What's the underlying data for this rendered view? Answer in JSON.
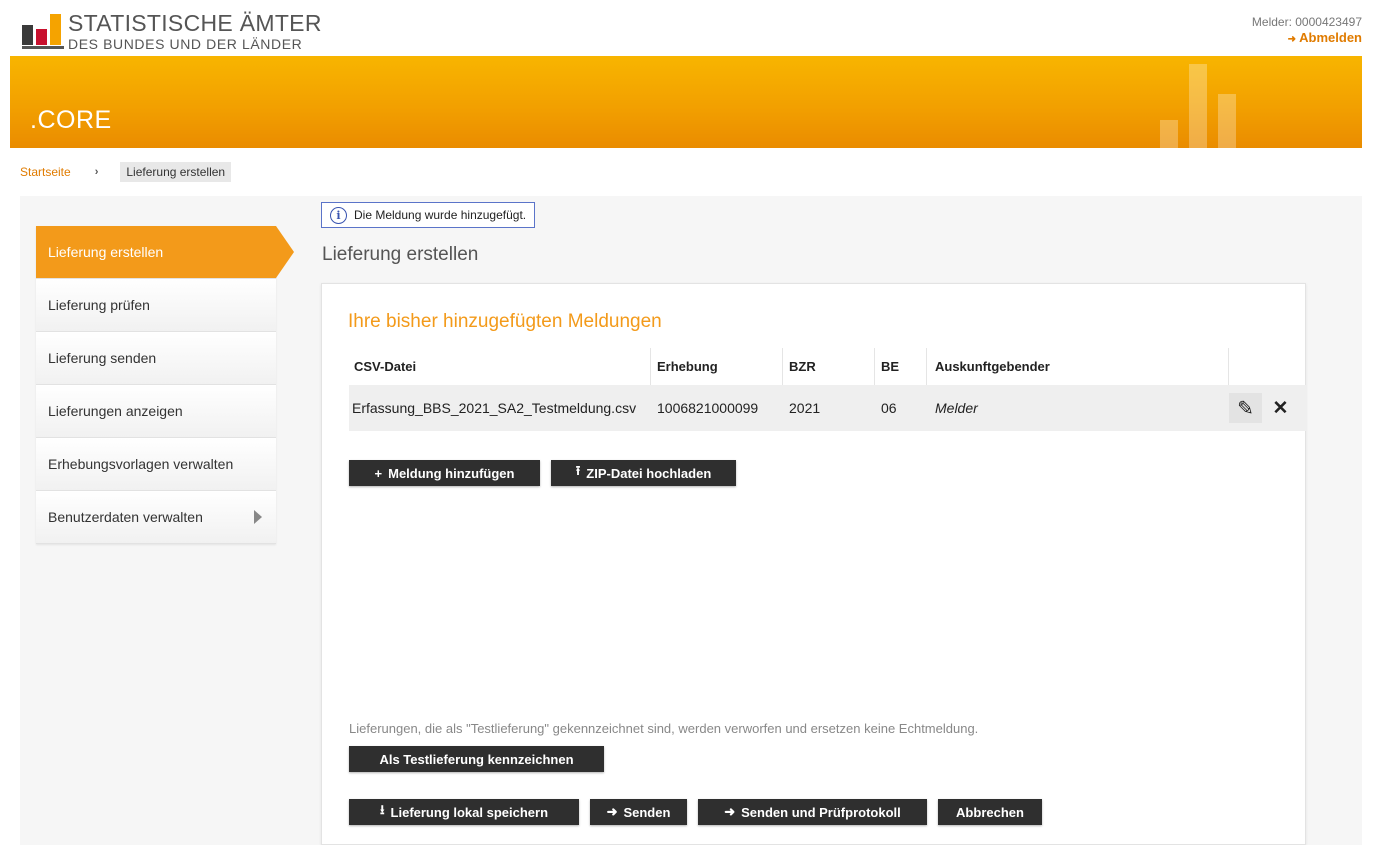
{
  "header": {
    "logo_line1": "STATISTISCHE ÄMTER",
    "logo_line2": "DES BUNDES UND DER LÄNDER",
    "melder": "Melder: 0000423497",
    "logout_icon": "arrow-right-icon",
    "logout_icon_glyph": "➜",
    "logout_label": "Abmelden",
    "app_title": ".CORE"
  },
  "breadcrumb": {
    "home": "Startseite",
    "separator": "›",
    "current": "Lieferung erstellen"
  },
  "sidebar": {
    "items": [
      {
        "label": "Lieferung erstellen",
        "active": true
      },
      {
        "label": "Lieferung prüfen"
      },
      {
        "label": "Lieferung senden"
      },
      {
        "label": "Lieferungen anzeigen"
      },
      {
        "label": "Erhebungsvorlagen verwalten"
      },
      {
        "label": "Benutzerdaten verwalten",
        "submenu": true
      }
    ]
  },
  "info_message": {
    "icon_glyph": "i",
    "text": "Die Meldung wurde hinzugefügt."
  },
  "page_heading": "Lieferung erstellen",
  "panel": {
    "title": "Ihre bisher hinzugefügten Meldungen",
    "table": {
      "headers": [
        "CSV-Datei",
        "Erhebung",
        "BZR",
        "BE",
        "Auskunftgebender"
      ],
      "rows": [
        {
          "csv": "Erfassung_BBS_2021_SA2_Testmeldung.csv",
          "erhebung": "1006821000099",
          "bzr": "2021",
          "be": "06",
          "auskunftgebender": "Melder"
        }
      ],
      "edit_glyph": "✎",
      "delete_glyph": "✕"
    },
    "buttons": {
      "add_icon": "+",
      "add_label": "Meldung hinzufügen",
      "zip_icon": "⭱",
      "zip_label": "ZIP-Datei hochladen",
      "test_label": "Als Testlieferung kennzeichnen",
      "save_icon": "⭳",
      "save_label": "Lieferung lokal speichern",
      "send_icon": "➜",
      "send_label": "Senden",
      "send_protocol_icon": "➜",
      "send_protocol_label": "Senden und Prüfprotokoll",
      "cancel_label": "Abbrechen"
    },
    "note": "Lieferungen, die als \"Testlieferung\" gekennzeichnet sind, werden verworfen und ersetzen keine Echtmeldung."
  },
  "colors": {
    "accent": "#f39a1a",
    "band": "#f2a000",
    "button": "#2f2f2f",
    "info_border": "#5b74c9"
  }
}
